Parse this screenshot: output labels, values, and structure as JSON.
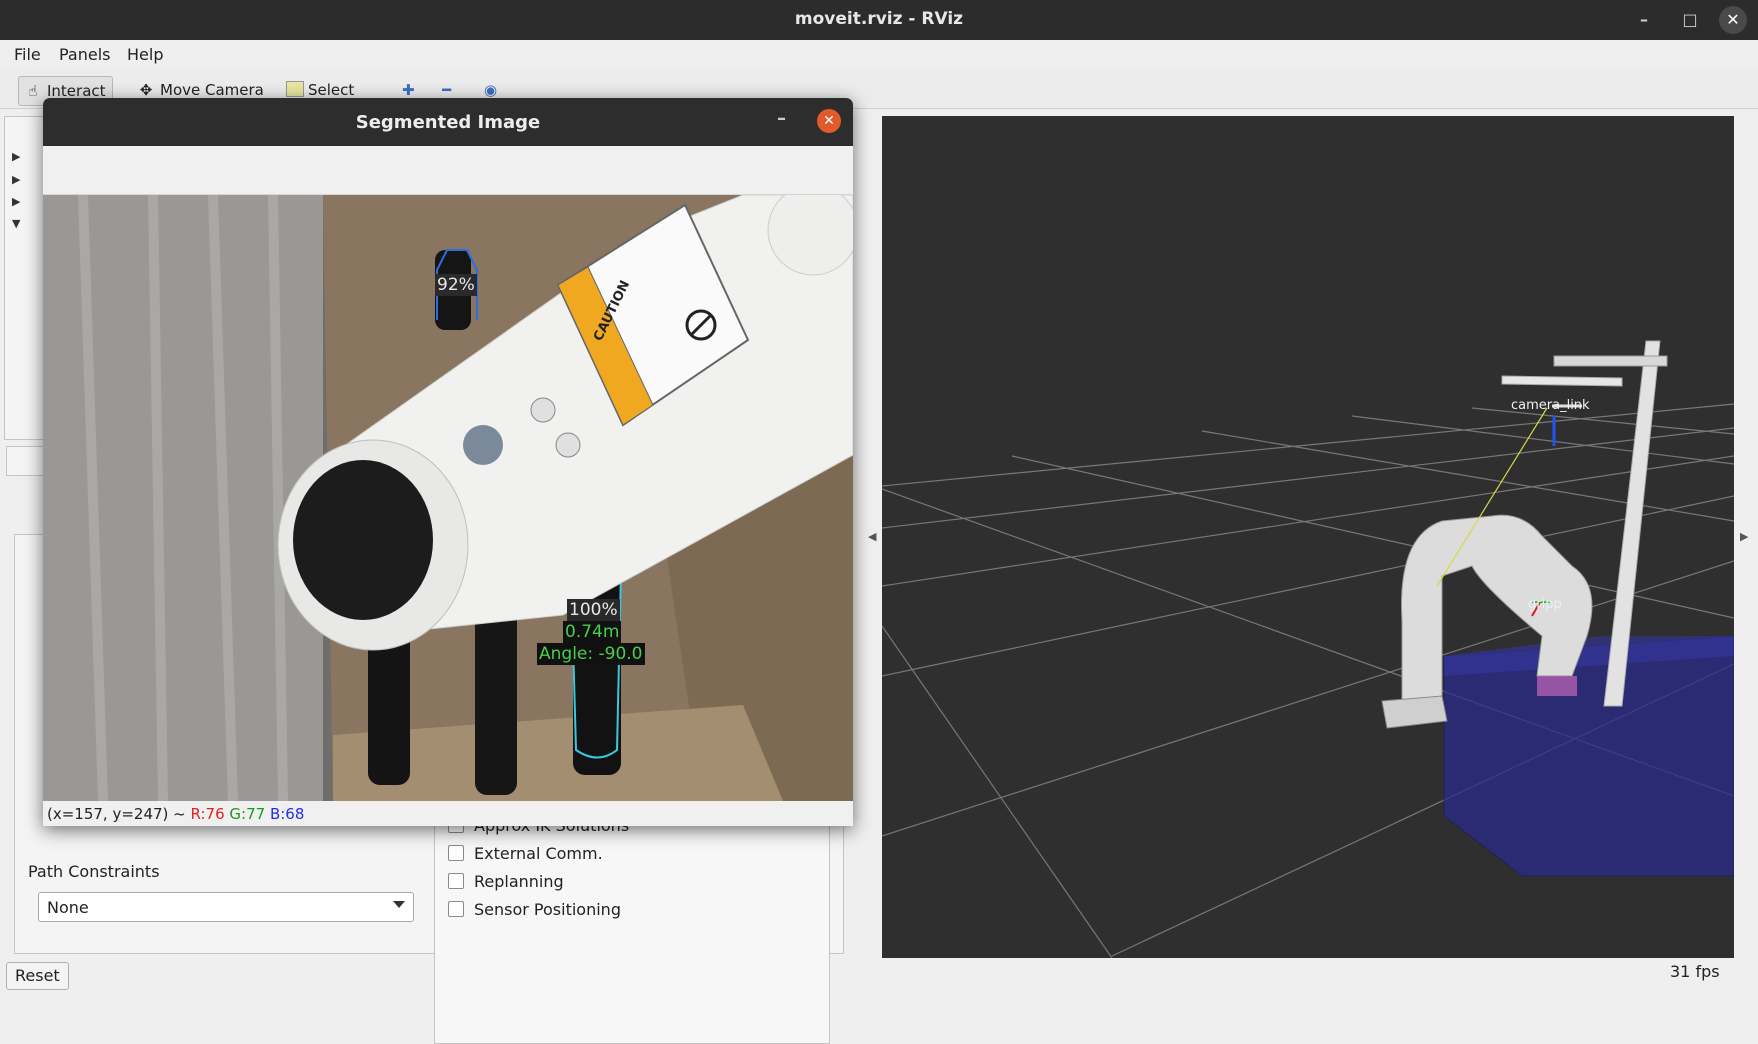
{
  "window": {
    "title": "moveit.rviz - RViz"
  },
  "menu": {
    "file": "File",
    "panels": "Panels",
    "help": "Help"
  },
  "toolbar": {
    "interact": "Interact",
    "move_camera": "Move Camera",
    "select": "Select"
  },
  "left": {
    "checkboxes": [
      "Approx IK Solutions",
      "External Comm.",
      "Replanning",
      "Sensor Positioning"
    ],
    "path_constraints_label": "Path Constraints",
    "path_constraints_value": "None",
    "reset_label": "Reset"
  },
  "viewport": {
    "fps": "31 fps",
    "labels": {
      "camera": "camera_link",
      "gripper": "gripp"
    }
  },
  "segmented": {
    "title": "Segmented Image",
    "detections": [
      {
        "confidence": "92%"
      },
      {
        "confidence": "100%",
        "distance": "0.74m",
        "angle": "Angle: -90.0"
      }
    ],
    "status": {
      "coords": "(x=157, y=247) ~",
      "r": "R:76",
      "g": "G:77",
      "b": "B:68"
    },
    "caution_text": "CAUTION"
  },
  "colors": {
    "accent_close": "#e05a2b",
    "status_r": "#e02020",
    "status_g": "#1a9a1a",
    "status_b": "#2030e0"
  }
}
